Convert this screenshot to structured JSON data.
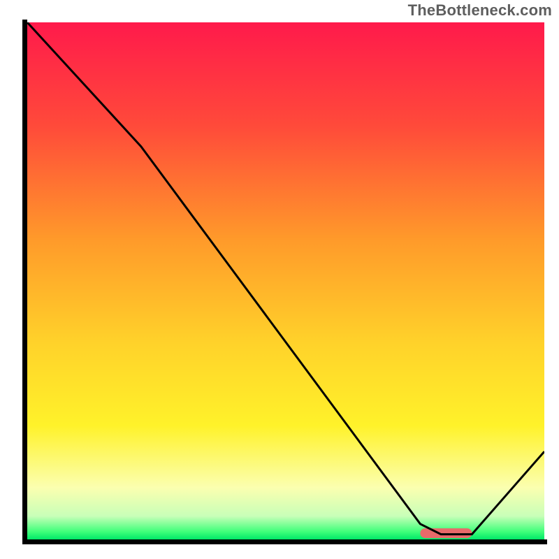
{
  "attribution": "TheBottleneck.com",
  "chart_data": {
    "type": "line",
    "title": "",
    "xlabel": "",
    "ylabel": "",
    "xlim": [
      0,
      100
    ],
    "ylim": [
      0,
      100
    ],
    "curve": [
      {
        "x": 0,
        "y": 100
      },
      {
        "x": 22,
        "y": 76
      },
      {
        "x": 76,
        "y": 3
      },
      {
        "x": 80,
        "y": 1
      },
      {
        "x": 86,
        "y": 1
      },
      {
        "x": 100,
        "y": 17
      }
    ],
    "marker_segment": {
      "x1": 76,
      "x2": 86,
      "y": 1.2
    },
    "gradient_stops": [
      {
        "offset": 0,
        "color": "#ff1a4b"
      },
      {
        "offset": 0.2,
        "color": "#ff4a3a"
      },
      {
        "offset": 0.42,
        "color": "#ff9a2a"
      },
      {
        "offset": 0.62,
        "color": "#ffd22a"
      },
      {
        "offset": 0.78,
        "color": "#fff22a"
      },
      {
        "offset": 0.9,
        "color": "#fbffb0"
      },
      {
        "offset": 0.955,
        "color": "#c8ffb8"
      },
      {
        "offset": 0.985,
        "color": "#3fff7a"
      },
      {
        "offset": 1.0,
        "color": "#00e868"
      }
    ],
    "axis_stroke": "#000000",
    "axis_stroke_width": 7,
    "curve_stroke": "#000000",
    "curve_stroke_width": 3,
    "marker_color": "#e86a6a",
    "marker_height": 14
  }
}
